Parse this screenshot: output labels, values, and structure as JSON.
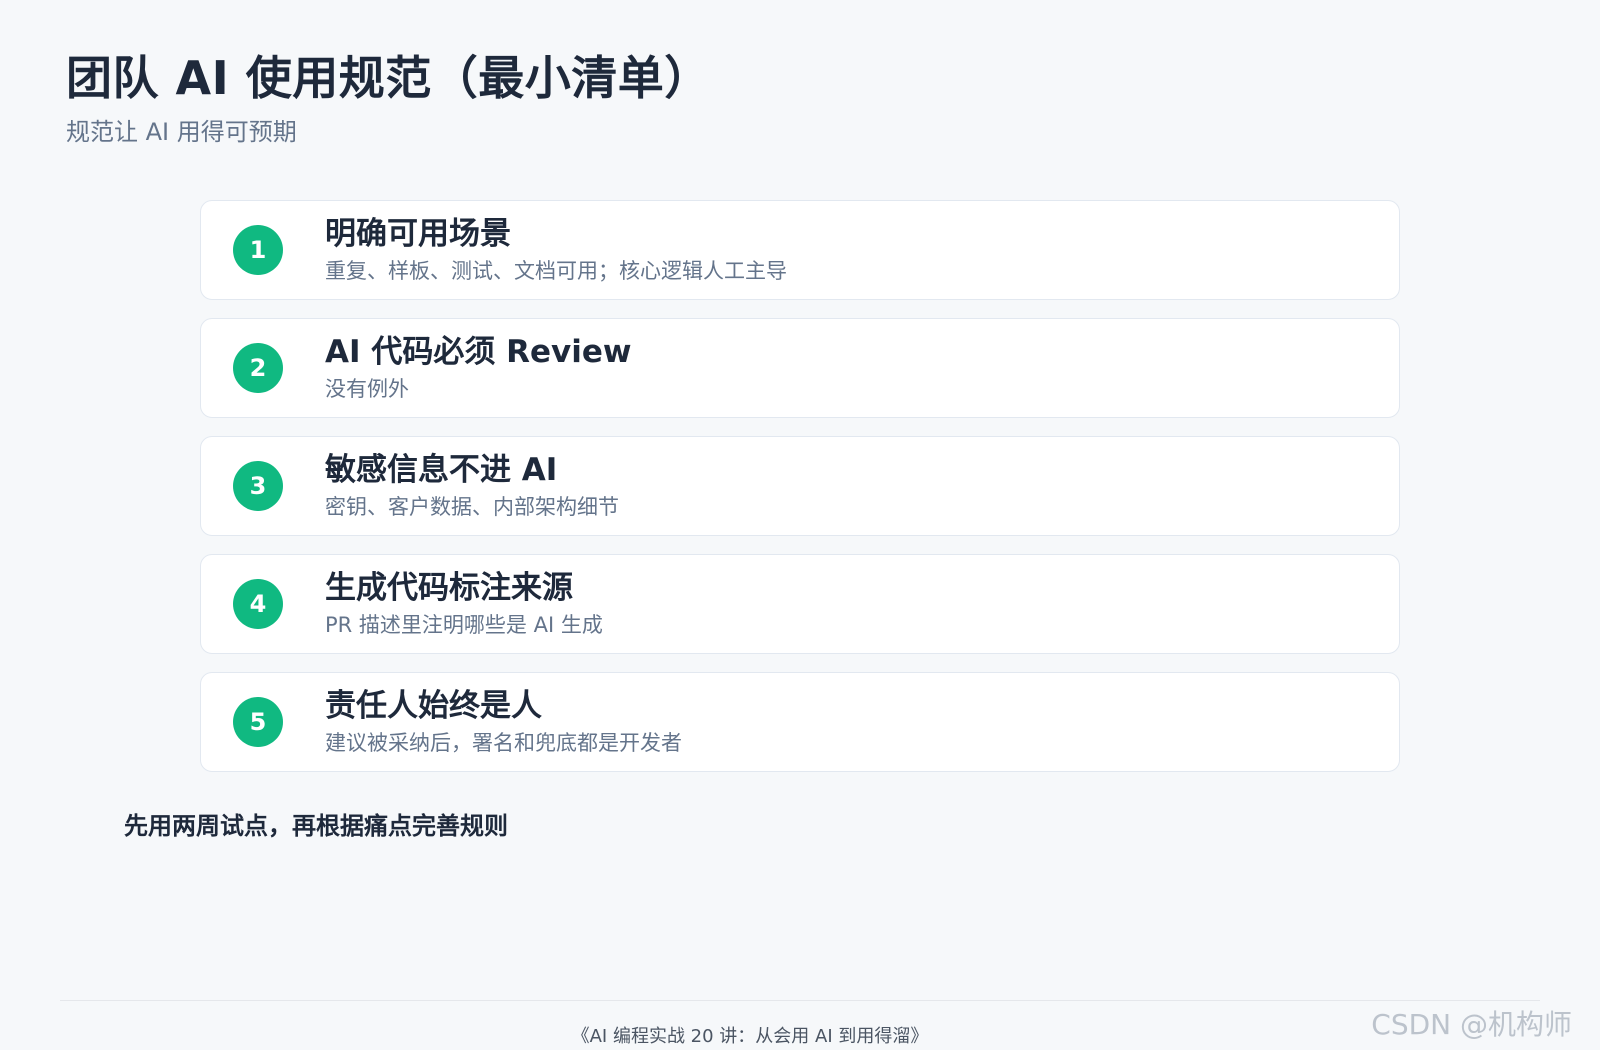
{
  "header": {
    "title": "团队 AI 使用规范（最小清单）",
    "subtitle": "规范让 AI 用得可预期"
  },
  "items": [
    {
      "number": "1",
      "title": "明确可用场景",
      "desc": "重复、样板、测试、文档可用；核心逻辑人工主导"
    },
    {
      "number": "2",
      "title": "AI 代码必须 Review",
      "desc": "没有例外"
    },
    {
      "number": "3",
      "title": "敏感信息不进 AI",
      "desc": "密钥、客户数据、内部架构细节"
    },
    {
      "number": "4",
      "title": "生成代码标注来源",
      "desc": "PR 描述里注明哪些是 AI 生成"
    },
    {
      "number": "5",
      "title": "责任人始终是人",
      "desc": "建议被采纳后，署名和兜底都是开发者"
    }
  ],
  "footnote": "先用两周试点，再根据痛点完善规则",
  "footer": {
    "text": "《AI 编程实战 20 讲：从会用 AI 到用得溜》",
    "watermark": "CSDN @机构师"
  },
  "colors": {
    "accent": "#10b981",
    "background": "#f6f8fa",
    "title": "#1e293b",
    "muted": "#64748b"
  }
}
